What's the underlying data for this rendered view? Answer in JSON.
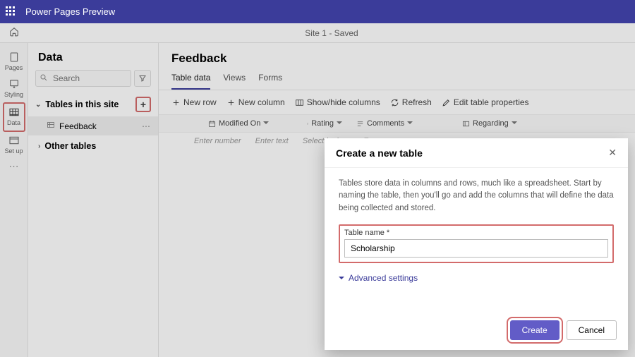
{
  "brand": {
    "title": "Power Pages Preview"
  },
  "subheader": {
    "site_label": "Site 1",
    "saved_label": "Saved"
  },
  "rail": {
    "pages": "Pages",
    "styling": "Styling",
    "data": "Data",
    "setup": "Set up"
  },
  "side": {
    "heading": "Data",
    "search_placeholder": "Search",
    "group_tables": "Tables in this site",
    "item_feedback": "Feedback",
    "group_other": "Other tables"
  },
  "content": {
    "title": "Feedback",
    "tabs": {
      "table_data": "Table data",
      "views": "Views",
      "forms": "Forms"
    },
    "toolbar": {
      "new_row": "New row",
      "new_column": "New column",
      "show_hide": "Show/hide columns",
      "refresh": "Refresh",
      "edit_props": "Edit table properties"
    },
    "grid": {
      "columns": {
        "modified_on": "Modified On",
        "rating": "Rating",
        "comments": "Comments",
        "regarding": "Regarding"
      },
      "placeholders": {
        "enter_number": "Enter number",
        "enter_text": "Enter text",
        "select_lookup": "Select lookup",
        "en": "En"
      }
    }
  },
  "modal": {
    "title": "Create a new table",
    "description": "Tables store data in columns and rows, much like a spreadsheet. Start by naming the table, then you'll go and add the columns that will define the data being collected and stored.",
    "field_label": "Table name *",
    "field_value": "Scholarship",
    "advanced": "Advanced settings",
    "create": "Create",
    "cancel": "Cancel"
  }
}
